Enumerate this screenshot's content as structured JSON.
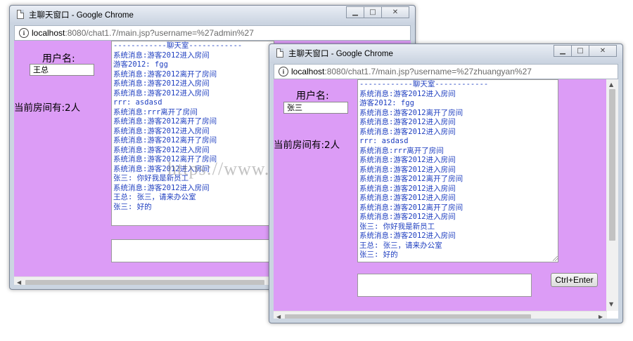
{
  "left_window": {
    "title": "主聊天窗口 - Google Chrome",
    "url_host": "localhost",
    "url_path": ":8080/chat1.7/main.jsp?username=%27admin%27",
    "username_label": "用户名:",
    "username_value": "王总",
    "room_count": "当前房间有:2人",
    "chat_lines": [
      "------------聊天室------------",
      "系统消息:游客2012进入房间",
      "游客2012: fgg",
      "系统消息:游客2012离开了房间",
      "系统消息:游客2012进入房间",
      "系统消息:游客2012进入房间",
      "rrr: asdasd",
      "系统消息:rrr离开了房间",
      "系统消息:游客2012离开了房间",
      "系统消息:游客2012进入房间",
      "系统消息:游客2012离开了房间",
      "系统消息:游客2012进入房间",
      "系统消息:游客2012离开了房间",
      "系统消息:游客2012进入房间",
      "张三: 你好我是新员工",
      "系统消息:游客2012进入房间",
      "王总: 张三，请来办公室",
      "张三: 好的"
    ]
  },
  "right_window": {
    "title": "主聊天窗口 - Google Chrome",
    "url_host": "localhost",
    "url_path": ":8080/chat1.7/main.jsp?username=%27zhuangyan%27",
    "username_label": "用户名:",
    "username_value": "张三",
    "room_count": "当前房间有:2人",
    "send_label": "Ctrl+Enter",
    "chat_lines": [
      "------------聊天室------------",
      "系统消息:游客2012进入房间",
      "游客2012: fgg",
      "系统消息:游客2012离开了房间",
      "系统消息:游客2012进入房间",
      "系统消息:游客2012进入房间",
      "rrr: asdasd",
      "系统消息:rrr离开了房间",
      "系统消息:游客2012进入房间",
      "系统消息:游客2012进入房间",
      "系统消息:游客2012离开了房间",
      "系统消息:游客2012进入房间",
      "系统消息:游客2012进入房间",
      "系统消息:游客2012离开了房间",
      "系统消息:游客2012进入房间",
      "张三: 你好我是新员工",
      "系统消息:游客2012进入房间",
      "王总: 张三，请来办公室",
      "张三: 好的"
    ]
  },
  "window_buttons": {
    "minimize": "▁",
    "maximize": "□",
    "close": "✕"
  },
  "watermark": "https://www.huzhan.com/ishop22",
  "colors": {
    "page_bg": "#dc9cf6",
    "chat_text": "#1f3fc0",
    "titlebar": "#c9d3e0"
  },
  "icons": [
    "page-icon",
    "info-icon",
    "minimize-icon",
    "maximize-icon",
    "close-icon",
    "resize-grip-icon",
    "scroll-left-arrow-icon",
    "scroll-right-arrow-icon",
    "scroll-up-arrow-icon",
    "scroll-down-arrow-icon"
  ]
}
